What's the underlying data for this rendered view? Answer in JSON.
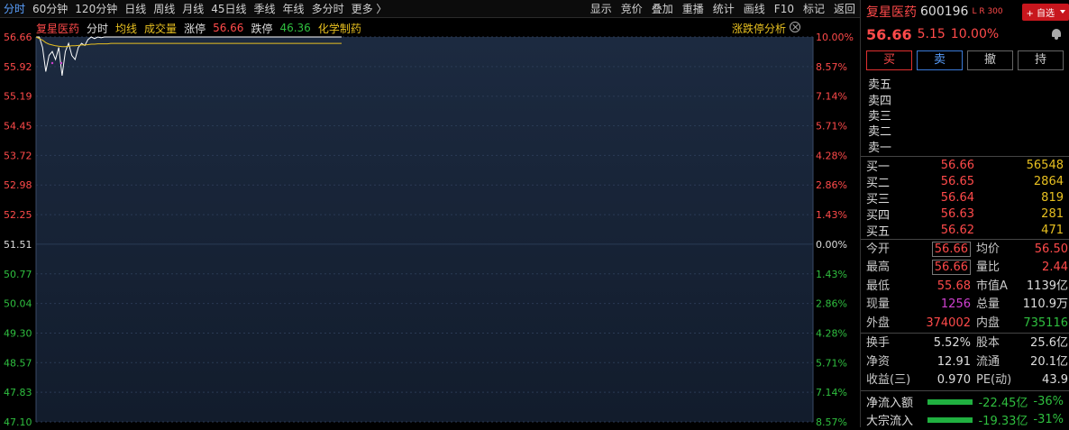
{
  "toolbar": {
    "periods": [
      {
        "label": "分时",
        "active": true
      },
      {
        "label": "60分钟"
      },
      {
        "label": "120分钟"
      },
      {
        "label": "日线"
      },
      {
        "label": "周线"
      },
      {
        "label": "月线"
      },
      {
        "label": "45日线"
      },
      {
        "label": "季线"
      },
      {
        "label": "年线"
      },
      {
        "label": "多分时"
      },
      {
        "label": "更多 〉"
      }
    ],
    "actions": [
      "显示",
      "竞价",
      "叠加",
      "重播",
      "统计",
      "画线",
      "F10",
      "标记",
      "返回"
    ]
  },
  "chart_info": {
    "stock": "复星医药",
    "mode": "分时",
    "avg": "均线",
    "vol": "成交量",
    "limit_up_label": "涨停",
    "limit_up": "56.66",
    "limit_down_label": "跌停",
    "limit_down": "46.36",
    "sector": "化学制药",
    "analysis": "涨跌停分析"
  },
  "chart_data": {
    "type": "line",
    "prev_close": 51.51,
    "ylim": [
      47.1,
      56.66
    ],
    "y_ticks_left": [
      "56.66",
      "55.92",
      "55.19",
      "54.45",
      "53.72",
      "52.98",
      "52.25",
      "51.51",
      "50.77",
      "50.04",
      "49.30",
      "48.57",
      "47.83",
      "47.10"
    ],
    "y_ticks_right": [
      "10.00%",
      "8.57%",
      "7.14%",
      "5.71%",
      "4.28%",
      "2.86%",
      "1.43%",
      "0.00%",
      "1.43%",
      "2.86%",
      "4.28%",
      "5.71%",
      "7.14%",
      "8.57%"
    ],
    "series": [
      {
        "values": [
          56.66,
          56.66,
          56.4,
          55.8,
          56.2,
          56.3,
          56.1,
          56.4,
          55.7,
          56.3,
          56.5,
          56.2,
          56.1,
          56.4,
          56.5,
          56.45,
          56.6,
          56.66,
          56.62,
          56.66,
          56.64,
          56.66,
          56.66,
          56.66,
          56.66,
          56.66,
          56.66,
          56.66,
          56.66,
          56.66,
          56.66,
          56.66,
          56.66,
          56.66,
          56.66,
          56.66,
          56.66,
          56.66,
          56.66,
          56.66,
          56.66,
          56.66,
          56.66,
          56.66,
          56.66,
          56.66,
          56.66,
          56.66,
          56.66,
          56.66,
          56.66,
          56.66,
          56.66,
          56.66,
          56.66,
          56.66,
          56.66,
          56.66,
          56.66,
          56.66,
          56.66,
          56.66,
          56.66,
          56.66,
          56.66,
          56.66,
          56.66,
          56.66,
          56.66,
          56.66,
          56.66,
          56.66,
          56.66,
          56.66,
          56.66,
          56.66,
          56.66,
          56.66,
          56.66,
          56.66,
          56.66,
          56.66,
          56.66,
          56.66,
          56.66,
          56.66,
          56.66,
          56.66,
          56.66,
          56.66,
          56.66,
          56.66,
          56.66,
          56.66,
          56.66
        ]
      },
      {
        "values": [
          56.66,
          56.62,
          56.58,
          56.52,
          56.48,
          56.46,
          56.44,
          56.43,
          56.42,
          56.42,
          56.43,
          56.44,
          56.44,
          56.45,
          56.46,
          56.46,
          56.47,
          56.48,
          56.48,
          56.49,
          56.49,
          56.49,
          56.49,
          56.5,
          56.5,
          56.5,
          56.5,
          56.5,
          56.5,
          56.5,
          56.5,
          56.5,
          56.5,
          56.5,
          56.5,
          56.5,
          56.5,
          56.5,
          56.5,
          56.5,
          56.5,
          56.5,
          56.5,
          56.5,
          56.5,
          56.5,
          56.5,
          56.5,
          56.5,
          56.5,
          56.5,
          56.5,
          56.5,
          56.5,
          56.5,
          56.5,
          56.5,
          56.5,
          56.5,
          56.5,
          56.5,
          56.5,
          56.5,
          56.5,
          56.5,
          56.5,
          56.5,
          56.5,
          56.5,
          56.5,
          56.5,
          56.5,
          56.5,
          56.5,
          56.5,
          56.5,
          56.5,
          56.5,
          56.5,
          56.5,
          56.5,
          56.5,
          56.5,
          56.5,
          56.5,
          56.5,
          56.5,
          56.5,
          56.5,
          56.5,
          56.5,
          56.5,
          56.5,
          56.5,
          56.5
        ]
      }
    ],
    "total_points": 240,
    "colors": {
      "price": "#ffffff",
      "avg": "#e8c020",
      "up": "#ff4a4a",
      "down": "#2fbf3f",
      "grid": "#2a3a55"
    }
  },
  "quote": {
    "name": "复星医药",
    "code": "600196",
    "tag": "L R 300",
    "add_btn": "+ 自选",
    "price": "56.66",
    "change": "5.15",
    "pct": "10.00%",
    "buttons": {
      "buy": "买",
      "sell": "卖",
      "cancel": "撤",
      "hold": "持"
    },
    "asks": [
      "卖五",
      "卖四",
      "卖三",
      "卖二",
      "卖一"
    ],
    "bids": [
      {
        "label": "买一",
        "price": "56.66",
        "vol": "56548"
      },
      {
        "label": "买二",
        "price": "56.65",
        "vol": "2864"
      },
      {
        "label": "买三",
        "price": "56.64",
        "vol": "819"
      },
      {
        "label": "买四",
        "price": "56.63",
        "vol": "281"
      },
      {
        "label": "买五",
        "price": "56.62",
        "vol": "471"
      }
    ],
    "stats": {
      "open_l": "今开",
      "open": "56.66",
      "avg_l": "均价",
      "avg": "56.50",
      "high_l": "最高",
      "high": "56.66",
      "vr_l": "量比",
      "vr": "2.44",
      "low_l": "最低",
      "low": "55.68",
      "mcap_l": "市值A",
      "mcap": "1139亿",
      "cur_l": "现量",
      "cur": "1256",
      "tvol_l": "总量",
      "tvol": "110.9万",
      "out_l": "外盘",
      "out": "374002",
      "in_l": "内盘",
      "in": "735116"
    },
    "fund": {
      "turn_l": "换手",
      "turn": "5.52%",
      "cap_l": "股本",
      "cap": "25.6亿",
      "na_l": "净资",
      "na": "12.91",
      "flt_l": "流通",
      "flt": "20.1亿",
      "eps_l": "收益(三)",
      "eps": "0.970",
      "pe_l": "PE(动)",
      "pe": "43.9"
    },
    "flows": [
      {
        "label": "净流入额",
        "value": "-22.45亿",
        "pct": "-36%"
      },
      {
        "label": "大宗流入",
        "value": "-19.33亿",
        "pct": "-31%"
      }
    ]
  }
}
